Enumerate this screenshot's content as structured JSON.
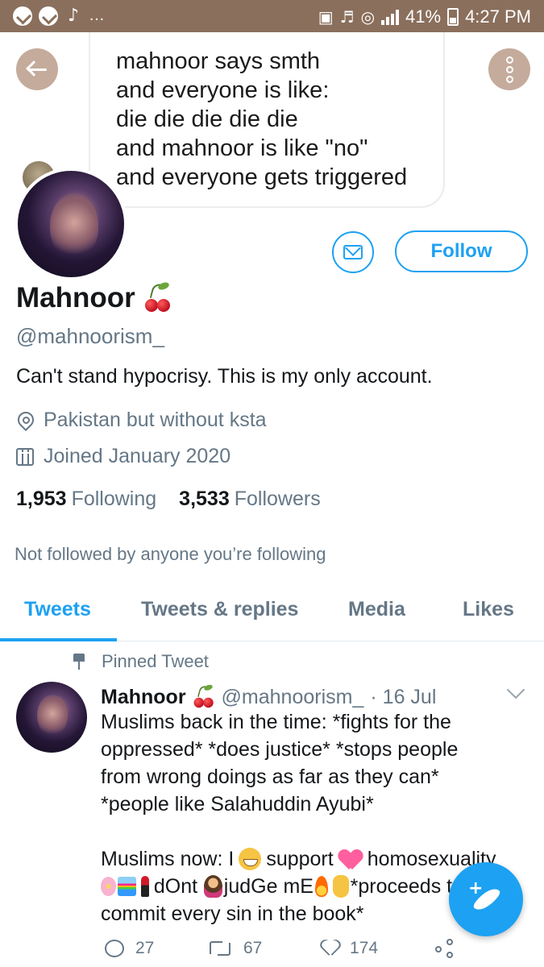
{
  "status_bar": {
    "battery": "41%",
    "time": "4:27 PM",
    "overflow_glyph": "…"
  },
  "banner": {
    "image_text_lines": [
      "mahnoor says smth",
      "and everyone is like:",
      "die die die die die",
      "and mahnoor is like \"no\"",
      "and everyone gets triggered"
    ]
  },
  "profile": {
    "name": "Mahnoor",
    "handle": "@mahnoorism_",
    "bio": "Can't stand hypocrisy. This is my only account.",
    "location": "Pakistan but without ksta",
    "joined": "Joined January 2020",
    "following_count": "1,953",
    "following_label": "Following",
    "followers_count": "3,533",
    "followers_label": "Followers",
    "not_followed_text": "Not followed by anyone you’re following",
    "follow_button_label": "Follow"
  },
  "tabs": [
    {
      "label": "Tweets",
      "active": true
    },
    {
      "label": "Tweets & replies",
      "active": false
    },
    {
      "label": "Media",
      "active": false
    },
    {
      "label": "Likes",
      "active": false
    }
  ],
  "pinned_tweet": {
    "pinned_label": "Pinned Tweet",
    "author": "Mahnoor",
    "handle": "@mahnoorism_",
    "date": "· 16 Jul",
    "lines": [
      "Muslims back in the time: *fights for the",
      "oppressed* *does justice* *stops people",
      "from wrong doings as far as they can*",
      "*people like Salahuddin Ayubi*"
    ],
    "line5_parts": [
      "Muslims now: I",
      "support",
      "homosexuality"
    ],
    "line6_parts": [
      "dOnt",
      "judGe mE",
      "*proceeds to"
    ],
    "line7": "commit every sin in the book*",
    "replies": "27",
    "retweets": "67",
    "likes": "174"
  },
  "icons": {
    "back": "arrow-left-icon",
    "more": "more-vertical-icon",
    "message": "envelope-icon",
    "location": "location-pin-icon",
    "calendar": "calendar-icon",
    "pin": "pushpin-icon",
    "compose": "compose-tweet-icon"
  },
  "colors": {
    "status_bar": "#8a6f5c",
    "accent": "#1da1f2",
    "secondary_text": "#657786",
    "round_button": "#c4ab9b"
  }
}
